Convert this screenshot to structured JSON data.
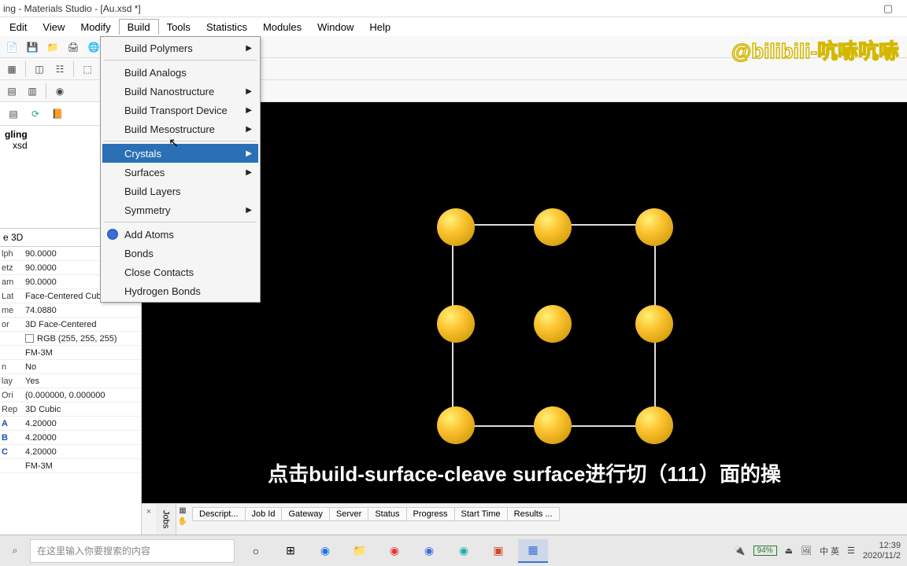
{
  "title": "ing - Materials Studio - [Au.xsd *]",
  "menus": [
    "Edit",
    "View",
    "Modify",
    "Build",
    "Tools",
    "Statistics",
    "Modules",
    "Window",
    "Help"
  ],
  "open_menu_index": 3,
  "build_menu": {
    "groups": [
      [
        {
          "label": "Build Polymers",
          "sub": true
        }
      ],
      [
        {
          "label": "Build Analogs"
        },
        {
          "label": "Build Nanostructure",
          "sub": true
        },
        {
          "label": "Build Transport Device",
          "sub": true
        },
        {
          "label": "Build Mesostructure",
          "sub": true
        }
      ],
      [
        {
          "label": "Crystals",
          "sub": true,
          "hl": true
        },
        {
          "label": "Surfaces",
          "sub": true
        },
        {
          "label": "Build Layers"
        },
        {
          "label": "Symmetry",
          "sub": true
        }
      ],
      [
        {
          "label": "Add Atoms",
          "icon": true
        },
        {
          "label": "Bonds"
        },
        {
          "label": "Close Contacts"
        },
        {
          "label": "Hydrogen Bonds"
        }
      ]
    ]
  },
  "watermark": "@bilibili-吭哧吭哧",
  "project": {
    "name": "gling",
    "file": "xsd"
  },
  "lattice_selector": "e 3D",
  "props": [
    {
      "k": "lph",
      "v": "90.0000"
    },
    {
      "k": "etz",
      "v": "90.0000"
    },
    {
      "k": "am",
      "v": "90.0000"
    },
    {
      "k": "Lat",
      "v": "Face-Centered Cubic"
    },
    {
      "k": "me",
      "v": "74.0880"
    },
    {
      "k": "or",
      "v": "3D Face-Centered"
    },
    {
      "k": "",
      "v": "RGB (255, 255, 255)",
      "chk": true
    },
    {
      "k": "",
      "v": "FM-3M"
    },
    {
      "k": "n",
      "v": "No"
    },
    {
      "k": "lay",
      "v": "Yes"
    },
    {
      "k": "Ori",
      "v": "(0.000000, 0.000000"
    },
    {
      "k": "Rep",
      "v": "3D Cubic"
    },
    {
      "k": "A",
      "v": "4.20000",
      "blue": true
    },
    {
      "k": "B",
      "v": "4.20000",
      "blue": true
    },
    {
      "k": "C",
      "v": "4.20000",
      "blue": true
    },
    {
      "k": "",
      "v": "FM-3M"
    }
  ],
  "caption": "点击build-surface-cleave surface进行切（111）面的操",
  "jobs_headers": [
    "Descript...",
    "Job Id",
    "Gateway",
    "Server",
    "Status",
    "Progress",
    "Start Time",
    "Results ..."
  ],
  "jobs_tab": "Jobs",
  "taskbar": {
    "search_placeholder": "在这里输入你要搜索的内容",
    "battery": "94%",
    "ime": "中 英",
    "time": "12:39",
    "date": "2020/11/2"
  }
}
